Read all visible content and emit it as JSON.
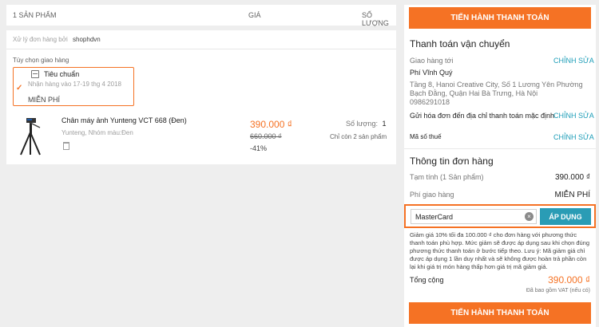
{
  "cart_header": {
    "items_count": "1 SẢN PHẨM",
    "price": "GIÁ",
    "quantity": "SỐ LƯỢNG"
  },
  "shop": {
    "handled_by_label": "Xử lý đơn hàng bởi",
    "name": "shophdvn"
  },
  "shipping": {
    "option_label": "Tùy chọn giao hàng",
    "method": "Tiêu chuẩn",
    "eta": "Nhận hàng vào 17-19 thg 4 2018",
    "fee": "MIỄN PHÍ"
  },
  "product": {
    "name": "Chân máy ảnh Yunteng VCT 668 (Đen)",
    "meta": "Yunteng, Nhóm màu:Đen",
    "price": "390.000 ₫",
    "old_price": "660.000 ₫",
    "discount": "-41%",
    "quantity_label": "Số lượng:",
    "quantity": "1",
    "stock": "Chỉ còn 2 sản phẩm"
  },
  "summary": {
    "checkout_top": "TIẾN HÀNH THANH TOÁN",
    "shipping_title": "Thanh toán vận chuyển",
    "deliver_to": "Giao hàng tới",
    "edit1": "CHỈNH SỬA",
    "recipient": "Phí Vĩnh Quý",
    "address": "Tầng 8, Hanoi Creative City, Số 1 Lương Yên Phường Bạch Đằng, Quận Hai Bà Trưng, Hà Nội",
    "phone": "0986291018",
    "invoice": "Gửi hóa đơn đến địa chỉ thanh toán mặc định",
    "edit2": "CHỈNH SỬA",
    "tax": "Mã số thuế",
    "edit3": "CHỈNH SỬA",
    "order_title": "Thông tin đơn hàng",
    "subtotal_label": "Tạm tính (1 Sản phẩm)",
    "subtotal": "390.000 ₫",
    "ship_fee_label": "Phí giao hàng",
    "ship_fee": "MIỄN PHÍ",
    "voucher_value": "MasterCard",
    "apply": "ÁP DỤNG",
    "promo_note": "Giảm giá 10% tối đa 100.000 ₫ cho đơn hàng với phương thức thanh toán phù hợp. Mức giảm sẽ được áp dụng sau khi chọn đúng phương thức thanh toán ở bước tiếp theo. Lưu ý: Mã giảm giá chỉ được áp dụng 1 lần duy nhất và sẽ không được hoàn trả phần còn lại khi giá trị món hàng thấp hơn giá trị mã giảm giá.",
    "total_label": "Tổng cộng",
    "total": "390.000 ₫",
    "vat_note": "Đã bao gồm VAT (nếu có)",
    "checkout_bottom": "TIẾN HÀNH THANH TOÁN"
  },
  "colors": {
    "accent": "#f57224",
    "link": "#1a9cb7",
    "apply_button": "#2a9cb5"
  }
}
